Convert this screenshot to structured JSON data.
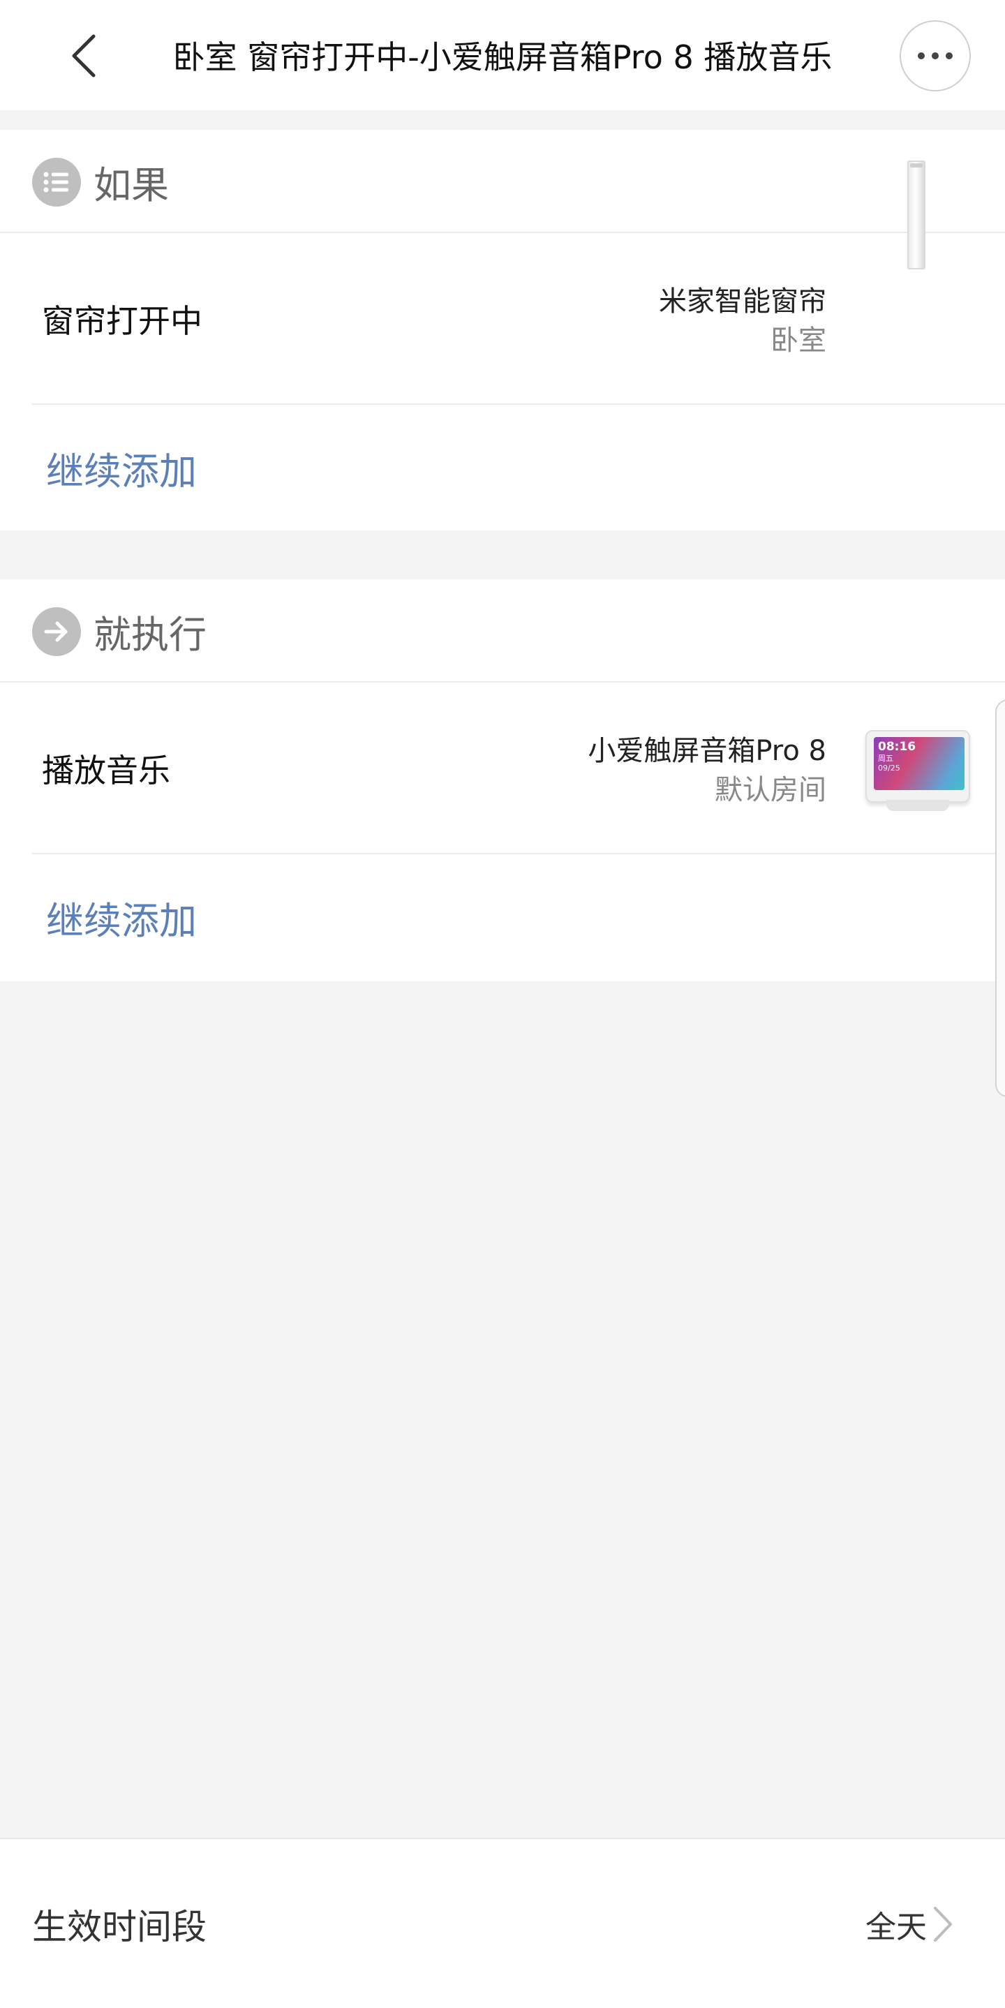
{
  "header": {
    "title": "卧室 窗帘打开中-小爱触屏音箱Pro 8 播放音乐",
    "back_icon": "chevron-left-icon",
    "more_icon": "more-dots-icon"
  },
  "if_section": {
    "title": "如果",
    "icon": "list-icon",
    "condition": {
      "label": "窗帘打开中",
      "device_name": "米家智能窗帘",
      "device_room": "卧室",
      "device_image": "curtain-image"
    },
    "add_more_label": "继续添加"
  },
  "then_section": {
    "title": "就执行",
    "icon": "arrow-right-icon",
    "action": {
      "label": "播放音乐",
      "device_name": "小爱触屏音箱Pro 8",
      "device_room": "默认房间",
      "device_image": "speaker-image",
      "screen_time": "08:16",
      "screen_day": "周五",
      "screen_date": "09/25"
    },
    "add_more_label": "继续添加"
  },
  "time_period": {
    "label": "生效时间段",
    "value": "全天",
    "chevron_icon": "chevron-right-icon"
  },
  "colors": {
    "background": "#f4f4f4",
    "card": "#ffffff",
    "link": "#5b7fb8",
    "section_icon": "#bfbfbf"
  }
}
